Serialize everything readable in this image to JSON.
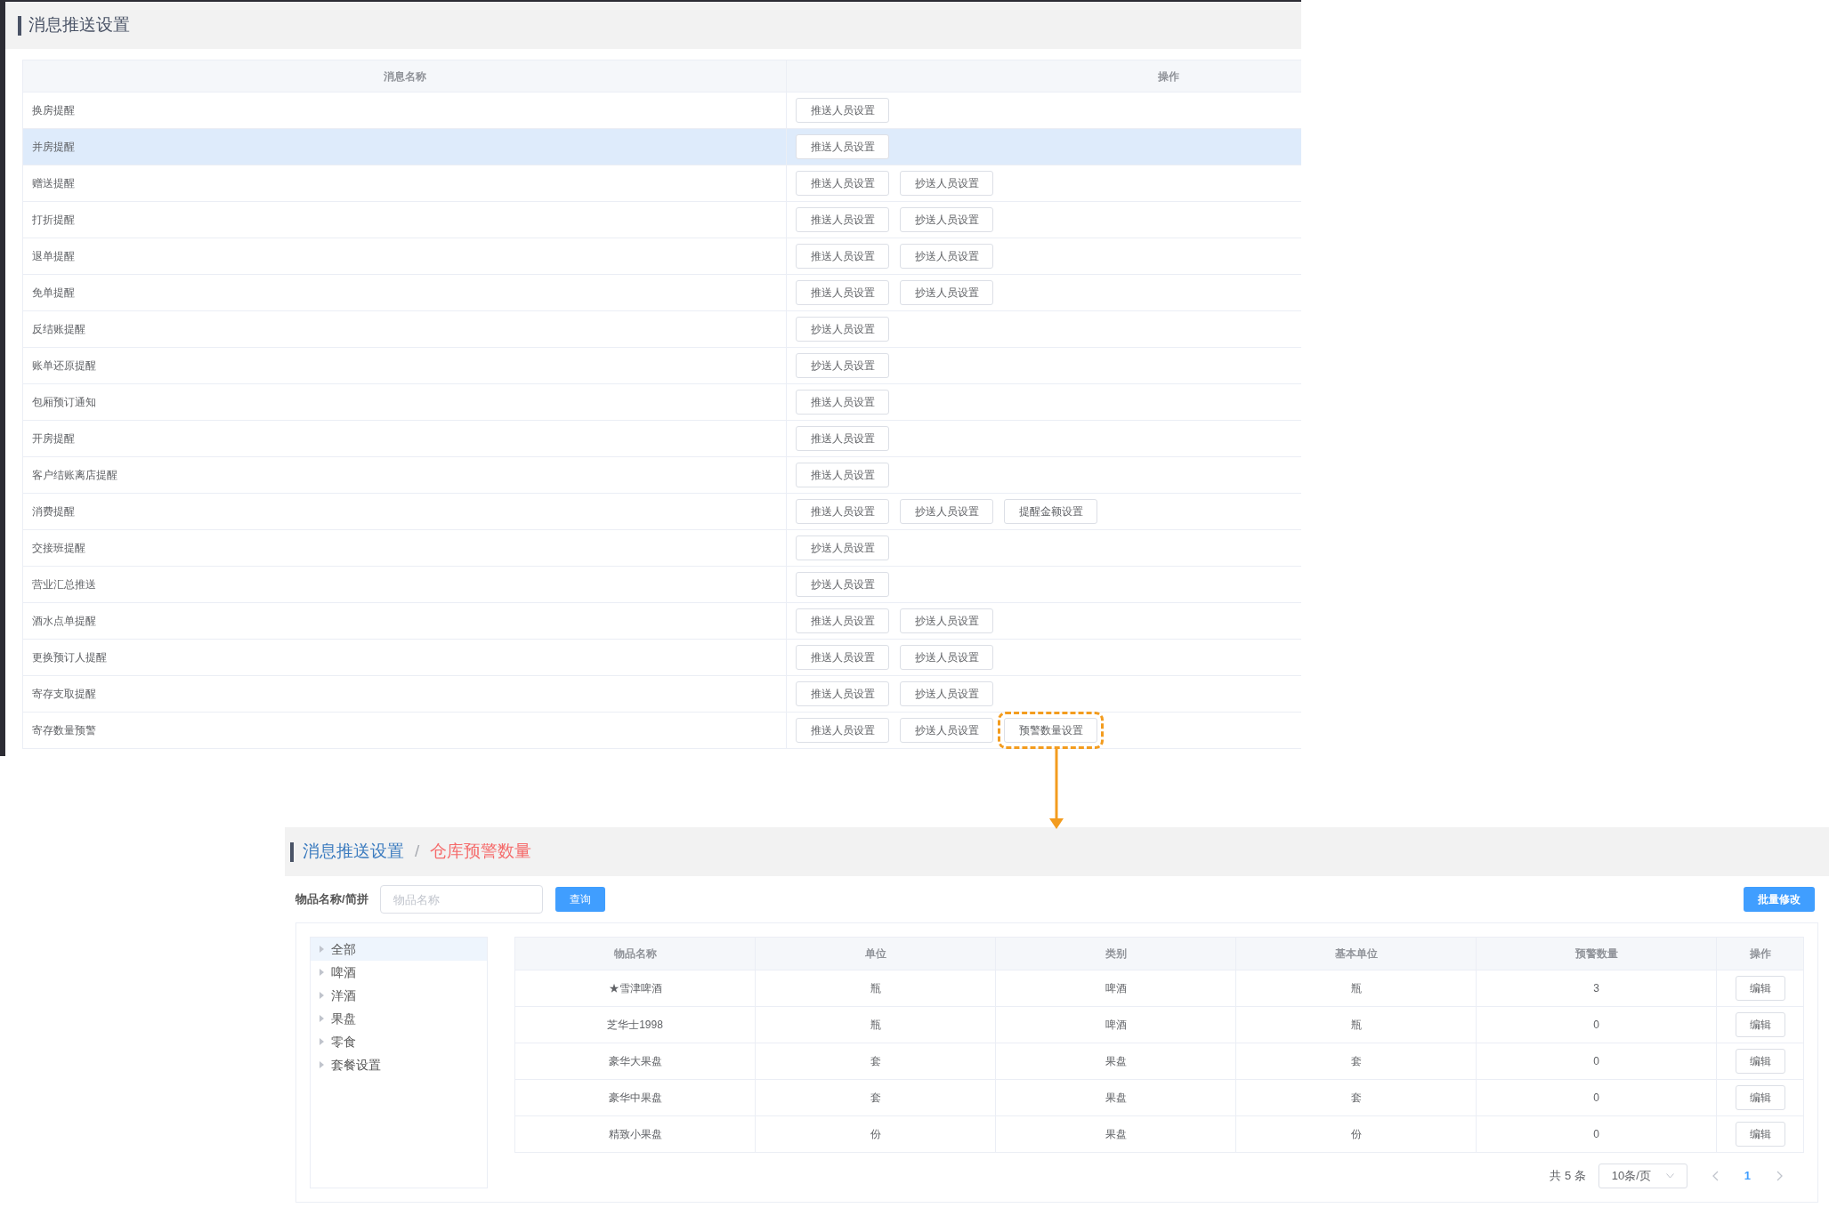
{
  "settings_page": {
    "title": "消息推送设置",
    "columns": [
      "消息名称",
      "操作"
    ],
    "rows": [
      {
        "name": "换房提醒",
        "highlighted": false,
        "buttons": [
          {
            "label": "推送人员设置",
            "callout": false
          }
        ]
      },
      {
        "name": "并房提醒",
        "highlighted": true,
        "buttons": [
          {
            "label": "推送人员设置",
            "callout": false
          }
        ]
      },
      {
        "name": "赠送提醒",
        "highlighted": false,
        "buttons": [
          {
            "label": "推送人员设置",
            "callout": false
          },
          {
            "label": "抄送人员设置",
            "callout": false
          }
        ]
      },
      {
        "name": "打折提醒",
        "highlighted": false,
        "buttons": [
          {
            "label": "推送人员设置",
            "callout": false
          },
          {
            "label": "抄送人员设置",
            "callout": false
          }
        ]
      },
      {
        "name": "退单提醒",
        "highlighted": false,
        "buttons": [
          {
            "label": "推送人员设置",
            "callout": false
          },
          {
            "label": "抄送人员设置",
            "callout": false
          }
        ]
      },
      {
        "name": "免单提醒",
        "highlighted": false,
        "buttons": [
          {
            "label": "推送人员设置",
            "callout": false
          },
          {
            "label": "抄送人员设置",
            "callout": false
          }
        ]
      },
      {
        "name": "反结账提醒",
        "highlighted": false,
        "buttons": [
          {
            "label": "抄送人员设置",
            "callout": false
          }
        ]
      },
      {
        "name": "账单还原提醒",
        "highlighted": false,
        "buttons": [
          {
            "label": "抄送人员设置",
            "callout": false
          }
        ]
      },
      {
        "name": "包厢预订通知",
        "highlighted": false,
        "buttons": [
          {
            "label": "推送人员设置",
            "callout": false
          }
        ]
      },
      {
        "name": "开房提醒",
        "highlighted": false,
        "buttons": [
          {
            "label": "推送人员设置",
            "callout": false
          }
        ]
      },
      {
        "name": "客户结账离店提醒",
        "highlighted": false,
        "buttons": [
          {
            "label": "推送人员设置",
            "callout": false
          }
        ]
      },
      {
        "name": "消费提醒",
        "highlighted": false,
        "buttons": [
          {
            "label": "推送人员设置",
            "callout": false
          },
          {
            "label": "抄送人员设置",
            "callout": false
          },
          {
            "label": "提醒金额设置",
            "callout": false
          }
        ]
      },
      {
        "name": "交接班提醒",
        "highlighted": false,
        "buttons": [
          {
            "label": "抄送人员设置",
            "callout": false
          }
        ]
      },
      {
        "name": "营业汇总推送",
        "highlighted": false,
        "buttons": [
          {
            "label": "抄送人员设置",
            "callout": false
          }
        ]
      },
      {
        "name": "酒水点单提醒",
        "highlighted": false,
        "buttons": [
          {
            "label": "推送人员设置",
            "callout": false
          },
          {
            "label": "抄送人员设置",
            "callout": false
          }
        ]
      },
      {
        "name": "更换预订人提醒",
        "highlighted": false,
        "buttons": [
          {
            "label": "推送人员设置",
            "callout": false
          },
          {
            "label": "抄送人员设置",
            "callout": false
          }
        ]
      },
      {
        "name": "寄存支取提醒",
        "highlighted": false,
        "buttons": [
          {
            "label": "推送人员设置",
            "callout": false
          },
          {
            "label": "抄送人员设置",
            "callout": false
          }
        ]
      },
      {
        "name": "寄存数量预警",
        "highlighted": false,
        "buttons": [
          {
            "label": "推送人员设置",
            "callout": false
          },
          {
            "label": "抄送人员设置",
            "callout": false
          },
          {
            "label": "预警数量设置",
            "callout": true
          }
        ]
      }
    ]
  },
  "warning_page": {
    "breadcrumb": [
      {
        "label": "消息推送设置",
        "selected": false
      },
      {
        "label": "仓库预警数量",
        "selected": true
      }
    ],
    "breadcrumb_separator": "/",
    "search": {
      "label": "物品名称/简拼",
      "placeholder": "物品名称",
      "button": "查询"
    },
    "batch_button": "批量修改",
    "tree": [
      {
        "label": "全部",
        "selected": true
      },
      {
        "label": "啤酒",
        "selected": false
      },
      {
        "label": "洋酒",
        "selected": false
      },
      {
        "label": "果盘",
        "selected": false
      },
      {
        "label": "零食",
        "selected": false
      },
      {
        "label": "套餐设置",
        "selected": false
      }
    ],
    "columns": [
      "物品名称",
      "单位",
      "类别",
      "基本单位",
      "预警数量",
      "操作"
    ],
    "rows": [
      [
        "★雪津啤酒",
        "瓶",
        "啤酒",
        "瓶",
        "3",
        "编辑"
      ],
      [
        "芝华士1998",
        "瓶",
        "啤酒",
        "瓶",
        "0",
        "编辑"
      ],
      [
        "豪华大果盘",
        "套",
        "果盘",
        "套",
        "0",
        "编辑"
      ],
      [
        "豪华中果盘",
        "套",
        "果盘",
        "套",
        "0",
        "编辑"
      ],
      [
        "精致小果盘",
        "份",
        "果盘",
        "份",
        "0",
        "编辑"
      ]
    ],
    "pagination": {
      "total": "共 5 条",
      "page_size": "10条/页",
      "pages": [
        {
          "label": "1",
          "selected": true
        }
      ]
    }
  }
}
